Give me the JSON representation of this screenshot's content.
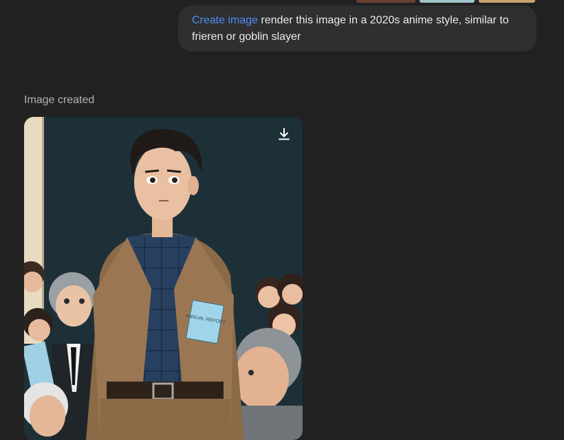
{
  "conversation": {
    "user_message": {
      "tool_label": "Create image",
      "text": " render this image in a 2020s anime style, similar to frieren or goblin slayer"
    },
    "assistant_message": {
      "status": "Image created",
      "generated_image": {
        "description_icon": "anime-illustration",
        "download_icon": "download-icon",
        "booklet_text": "ANNUAL REPORT"
      }
    }
  },
  "colors": {
    "background": "#212121",
    "bubble": "#2f2f2f",
    "accent": "#4e8ef7",
    "status": "#b4b4b4"
  }
}
